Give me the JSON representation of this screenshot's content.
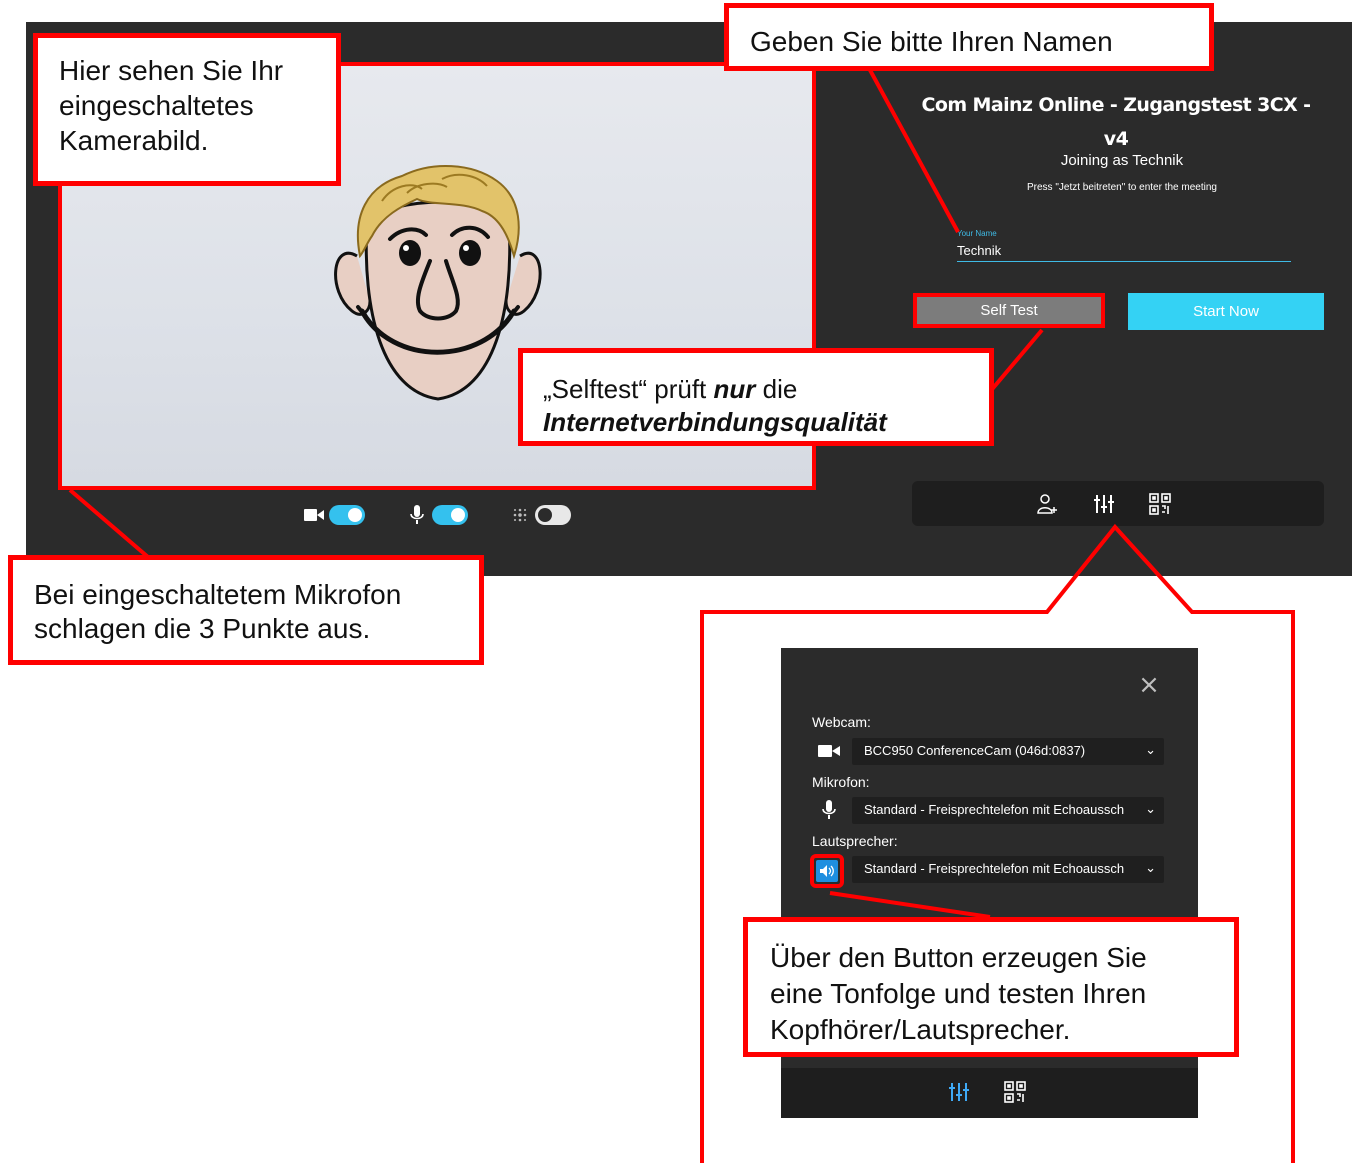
{
  "callouts": {
    "camera": [
      "Hier sehen Sie Ihr",
      "eingeschaltetes",
      "Kamerabild."
    ],
    "name": "Geben Sie bitte Ihren Namen",
    "selftest_quote": "„Selftest“ prüft",
    "selftest_emph": "nur",
    "selftest_after": "die",
    "selftest_line2": "Internetverbindungsqualität",
    "mic": [
      "Bei eingeschaltetem Mikrofon",
      "schlagen die 3 Punkte aus."
    ],
    "tone": [
      "Über den Button erzeugen Sie",
      "eine Tonfolge und testen Ihren",
      "Kopfhörer/Lautsprecher."
    ]
  },
  "meeting": {
    "title_line1": "Com Mainz Online - Zugangstest 3CX -",
    "title_line2": "v4",
    "joining": "Joining as Technik",
    "press": "Press \"Jetzt beitreten\" to enter the meeting",
    "name_label": "Your Name",
    "name_value": "Technik",
    "self_test": "Self Test",
    "start_now": "Start Now"
  },
  "toggles": {
    "camera": true,
    "microphone": true,
    "blur": false
  },
  "icons": {
    "camera": "video-camera-icon",
    "microphone": "microphone-icon",
    "blur": "blur-background-icon",
    "invite": "add-person-icon",
    "settings": "sliders-icon",
    "qr": "qr-code-icon",
    "speaker": "speaker-icon",
    "close": "close-icon"
  },
  "settings": {
    "close": "×",
    "webcam_label": "Webcam:",
    "webcam_value": "BCC950 ConferenceCam (046d:0837)",
    "mic_label": "Mikrofon:",
    "mic_value": "Standard - Freisprechtelefon mit Echoaussch",
    "speaker_label": "Lautsprecher:",
    "speaker_value": "Standard - Freisprechtelefon mit Echoaussch"
  },
  "colors": {
    "annotation_red": "#ff0000",
    "accent_cyan": "#34d2f4",
    "panel_dark": "#2b2b2b"
  }
}
